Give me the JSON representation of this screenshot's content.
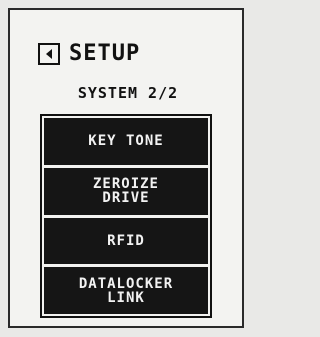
{
  "header": {
    "back_icon": "back-arrow-icon",
    "title": "SETUP"
  },
  "subtitle": "SYSTEM 2/2",
  "menu": {
    "items": [
      {
        "label": "KEY TONE"
      },
      {
        "label": "ZEROIZE\nDRIVE"
      },
      {
        "label": "RFID"
      },
      {
        "label": "DATALOCKER\nLINK"
      }
    ]
  },
  "colors": {
    "button_bg": "#151515",
    "button_text": "#f2f2f2",
    "screen_bg": "#f3f3f1",
    "ink": "#111111"
  }
}
